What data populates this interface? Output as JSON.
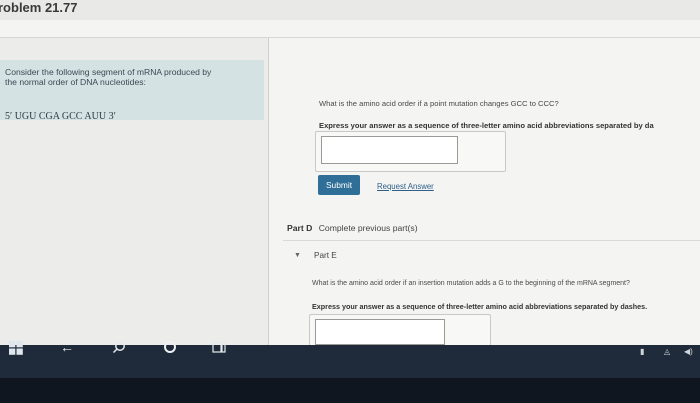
{
  "page": {
    "title": "roblem 21.77"
  },
  "context": {
    "lines": [
      "Consider the following segment of mRNA produced by",
      "the normal order of DNA nucleotides:"
    ],
    "sequence": "5′ UGU CGA GCC AUU 3′"
  },
  "part_c": {
    "question": "What is the amino acid order if a point mutation changes GCC to CCC?",
    "instruction": "Express your answer as a sequence of three-letter amino acid abbreviations separated by da",
    "answer_value": "",
    "submit_label": "Submit",
    "request_label": "Request Answer"
  },
  "part_d": {
    "label": "Part D",
    "text": "Complete previous part(s)"
  },
  "part_e": {
    "label": "Part E",
    "question": "What is the amino acid order if an insertion mutation adds a G to the beginning of the mRNA segment?",
    "instruction": "Express your answer as a sequence of three-letter amino acid abbreviations separated by dashes.",
    "answer_value": ""
  },
  "taskbar": {
    "icons": [
      "windows-icon",
      "back-arrow-icon",
      "search-icon",
      "cortana-icon",
      "task-view-icon"
    ],
    "tray_icons": [
      "battery-icon",
      "network-icon",
      "volume-icon"
    ]
  }
}
